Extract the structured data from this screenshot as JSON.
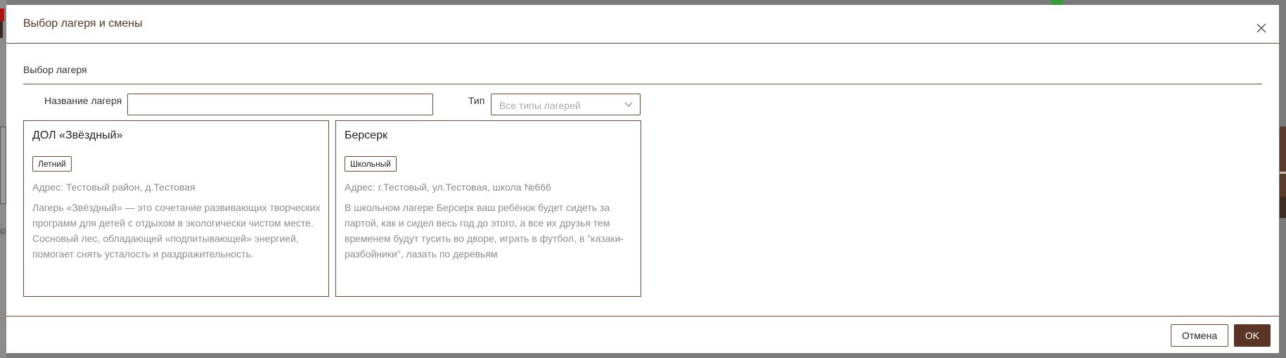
{
  "modal": {
    "title": "Выбор лагеря и смены",
    "close_icon": "close-icon"
  },
  "section": {
    "label": "Выбор лагеря"
  },
  "filters": {
    "name_label": "Название лагеря",
    "name_value": "",
    "type_label": "Тип",
    "type_placeholder": "Все типы лагерей",
    "type_icon": "chevron-down-icon"
  },
  "camps": [
    {
      "title": "ДОЛ «Звёздный»",
      "badge": "Летний",
      "address": "Адрес: Тестовый район, д.Тестовая",
      "description": "Лагерь «Звёздный» — это сочетание развивающих творческих программ для детей с отдыхом в экологически чистом месте. Сосновый лес, обладающей «подпитывающей» энергией, помогает снять усталость и раздражительность."
    },
    {
      "title": "Берсерк",
      "badge": "Школьный",
      "address": "Адрес: г.Тестовый, ул.Тестовая, школа №666",
      "description": "В школьном лагере Берсерк ваш ребёнок будет сидеть за партой, как и сидел весь год до этого, а все их друзья тем временем будут тусить во дворе, играть в футбол, в \"казаки-разбойники\", лазать по деревьям"
    }
  ],
  "footer": {
    "cancel_label": "Отмена",
    "ok_label": "OK"
  },
  "colors": {
    "accent": "#5a3424",
    "border": "#6b4a3a",
    "overlay": "#7a7a7a"
  }
}
